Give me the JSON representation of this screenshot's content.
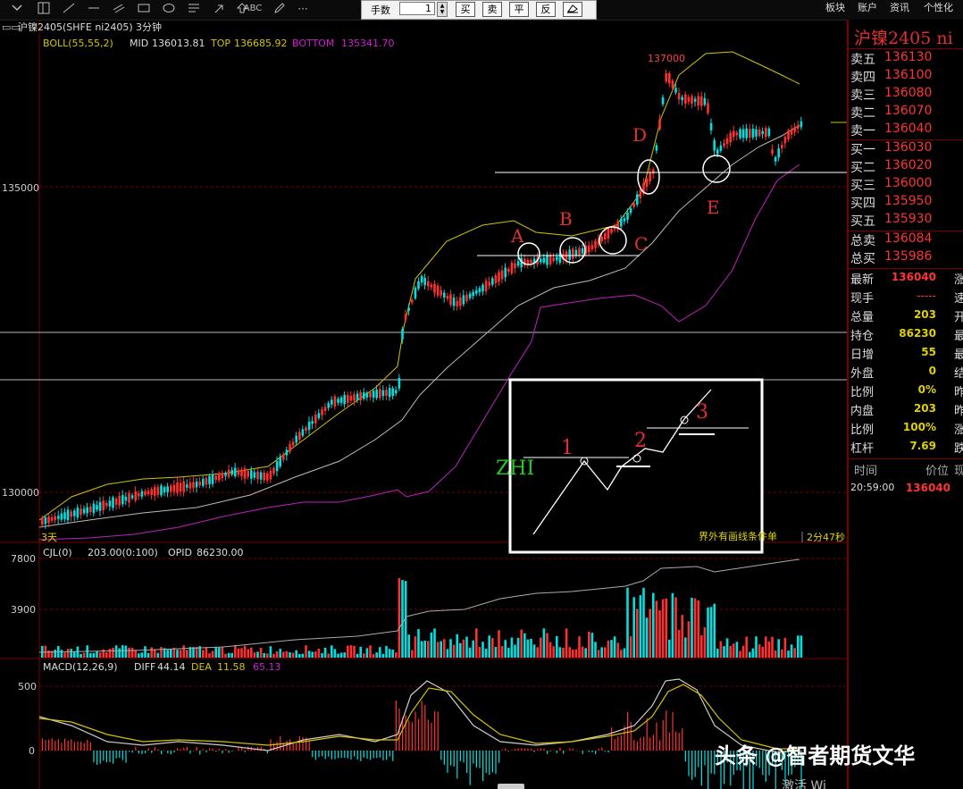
{
  "toolbar": {
    "icons": [
      "chevron-down-icon",
      "layout-icon",
      "line-icon",
      "horizontal-line-icon",
      "parallel-line-icon",
      "rectangle-icon",
      "ellipse-icon",
      "fibonacci-icon",
      "arrow-icon",
      "up-arrow-icon",
      "text-icon",
      "pencil-icon",
      "more-icon"
    ],
    "text_tool": "ABC",
    "more": "···",
    "order": {
      "qty_label": "手数",
      "qty_value": "1",
      "buy": "买",
      "sell": "卖",
      "flat": "平",
      "reverse": "反"
    },
    "menus": [
      "板块",
      "账户",
      "资讯",
      "个性化"
    ]
  },
  "chart": {
    "header_symbol": "沪镍2405(SHFE ni2405)",
    "period": "3分钟",
    "boll": {
      "label": "BOLL(55,55,2)",
      "mid_label": "MID",
      "mid": "136013.81",
      "top_label": "TOP",
      "top": "136685.92",
      "bottom_label": "BOTTOM",
      "bottom": "135341.70"
    },
    "y_ticks": [
      "135000",
      "130000"
    ],
    "peak_label": "137000",
    "range_label": "3天",
    "annotations": [
      "A",
      "B",
      "C",
      "D",
      "E"
    ],
    "inset": {
      "zhi": "ZHI",
      "n1": "1",
      "n2": "2",
      "n3": "3",
      "caption": "界外有画线条件单"
    },
    "timer": "2分47秒",
    "colors": {
      "up": "#ff3030",
      "down": "#00e0e0",
      "mid": "#cccccc",
      "top": "#d4c400",
      "bottom": "#c020c0",
      "grid": "#7a0000"
    }
  },
  "volume": {
    "header": "CJL(0)",
    "value": "203.00(0:100)",
    "opid_label": "OPID",
    "opid": "86230.00",
    "y_ticks": [
      "7800",
      "3900"
    ]
  },
  "macd": {
    "header": "MACD(12,26,9)",
    "diff_label": "DIFF",
    "diff": "44.14",
    "dea_label": "DEA",
    "dea": "11.58",
    "macd": "65.13",
    "y_ticks": [
      "500",
      "0"
    ]
  },
  "quote": {
    "title": "沪镍2405 ni",
    "asks": [
      {
        "label": "卖五",
        "price": "136130"
      },
      {
        "label": "卖四",
        "price": "136100"
      },
      {
        "label": "卖三",
        "price": "136080"
      },
      {
        "label": "卖二",
        "price": "136070"
      },
      {
        "label": "卖一",
        "price": "136040"
      }
    ],
    "bids": [
      {
        "label": "买一",
        "price": "136030"
      },
      {
        "label": "买二",
        "price": "136020"
      },
      {
        "label": "买三",
        "price": "136000"
      },
      {
        "label": "买四",
        "price": "135950"
      },
      {
        "label": "买五",
        "price": "135930"
      }
    ],
    "totals": [
      {
        "label": "总卖",
        "value": "136084"
      },
      {
        "label": "总买",
        "value": "135986"
      }
    ],
    "stats": [
      {
        "label": "最新",
        "value": "136040",
        "label2": "涨"
      },
      {
        "label": "现手",
        "value": "-----",
        "label2": "速"
      },
      {
        "label": "总量",
        "value": "203",
        "label2": "开"
      },
      {
        "label": "持仓",
        "value": "86230",
        "label2": "最"
      },
      {
        "label": "日增",
        "value": "55",
        "label2": "最"
      },
      {
        "label": "外盘",
        "value": "0",
        "label2": "结"
      },
      {
        "label": "比例",
        "value": "0%",
        "label2": "昨"
      },
      {
        "label": "内盘",
        "value": "203",
        "label2": "昨"
      },
      {
        "label": "比例",
        "value": "100%",
        "label2": "涨"
      },
      {
        "label": "杠杆",
        "value": "7.69",
        "label2": "跌"
      }
    ],
    "ticks_header": {
      "time": "时间",
      "price": "价位",
      "extra": "现"
    },
    "tick": {
      "time": "20:59:00",
      "price": "136040"
    }
  },
  "watermark": "头条 @智者期货文华",
  "bottom_text": "激活 Wi"
}
